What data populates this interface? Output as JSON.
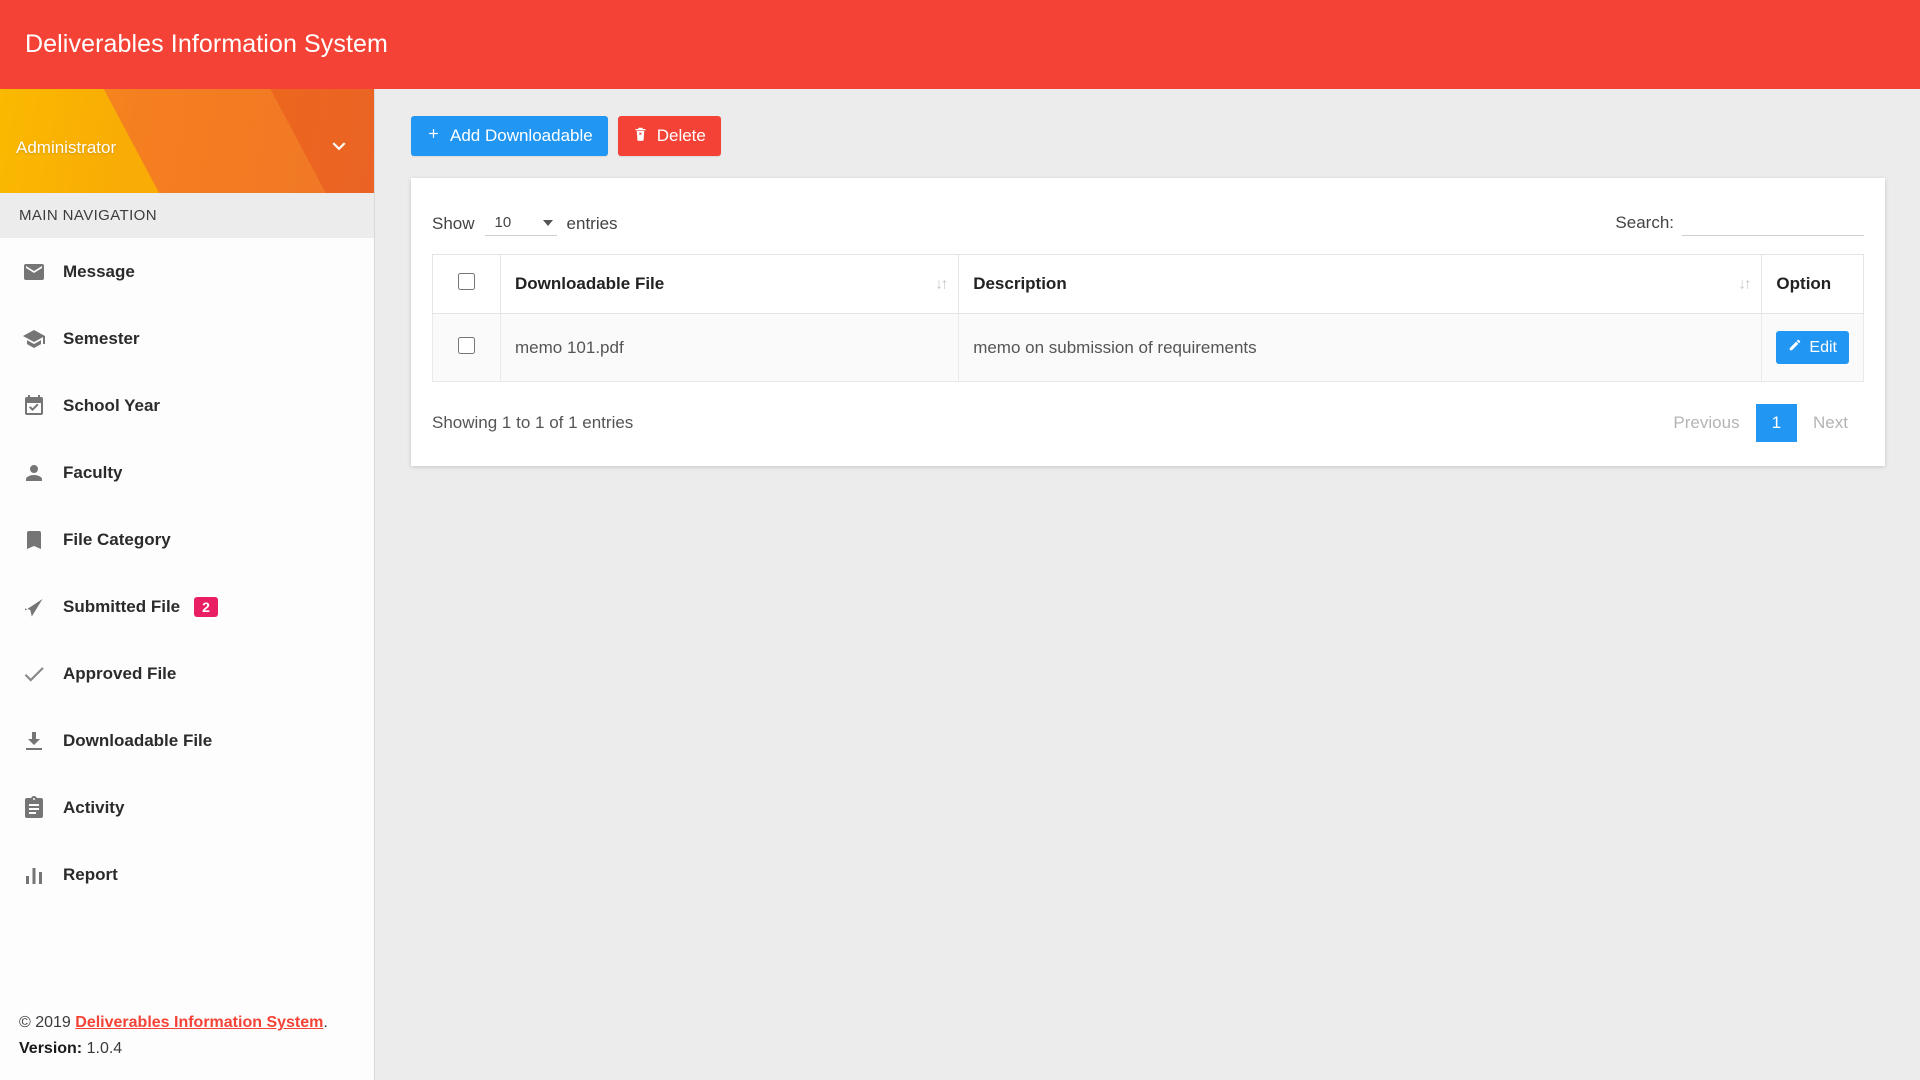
{
  "header": {
    "title": "Deliverables Information System"
  },
  "sidebar": {
    "user": {
      "name": "Administrator",
      "caret_icon": "chevron-down-icon"
    },
    "nav_header": "MAIN NAVIGATION",
    "items": [
      {
        "label": "Message",
        "icon": "envelope-icon"
      },
      {
        "label": "Semester",
        "icon": "graduation-cap-icon"
      },
      {
        "label": "School Year",
        "icon": "calendar-check-icon"
      },
      {
        "label": "Faculty",
        "icon": "person-icon"
      },
      {
        "label": "File Category",
        "icon": "bookmark-icon"
      },
      {
        "label": "Submitted File",
        "icon": "send-arrow-icon",
        "badge": "2"
      },
      {
        "label": "Approved File",
        "icon": "check-icon"
      },
      {
        "label": "Downloadable File",
        "icon": "download-icon"
      },
      {
        "label": "Activity",
        "icon": "clipboard-icon"
      },
      {
        "label": "Report",
        "icon": "bar-chart-icon"
      }
    ],
    "footer": {
      "copyright_prefix": "© 2019 ",
      "brand": "Deliverables Information System",
      "copyright_suffix": ".",
      "version_label": "Version:",
      "version_value": "1.0.4"
    }
  },
  "toolbar": {
    "add_label": "Add Downloadable",
    "add_icon": "plus-icon",
    "delete_label": "Delete",
    "delete_icon": "trash-icon"
  },
  "table_controls": {
    "show_label": "Show",
    "entries_label": "entries",
    "page_length": "10",
    "search_label": "Search:",
    "search_value": "",
    "search_placeholder": ""
  },
  "table": {
    "columns": [
      {
        "label": "",
        "sortable": false
      },
      {
        "label": "Downloadable File",
        "sortable": true
      },
      {
        "label": "Description",
        "sortable": true
      },
      {
        "label": "Option",
        "sortable": false
      }
    ],
    "rows": [
      {
        "file": "memo 101.pdf",
        "description": "memo on submission of requirements",
        "action_label": "Edit",
        "action_icon": "pencil-icon"
      }
    ]
  },
  "table_footer": {
    "showing_info": "Showing 1 to 1 of 1 entries",
    "previous_label": "Previous",
    "page_number": "1",
    "next_label": "Next"
  },
  "colors": {
    "brand_red": "#f44336",
    "accent_blue": "#2196f3",
    "badge_pink": "#e91e63",
    "content_bg": "#ececec"
  }
}
